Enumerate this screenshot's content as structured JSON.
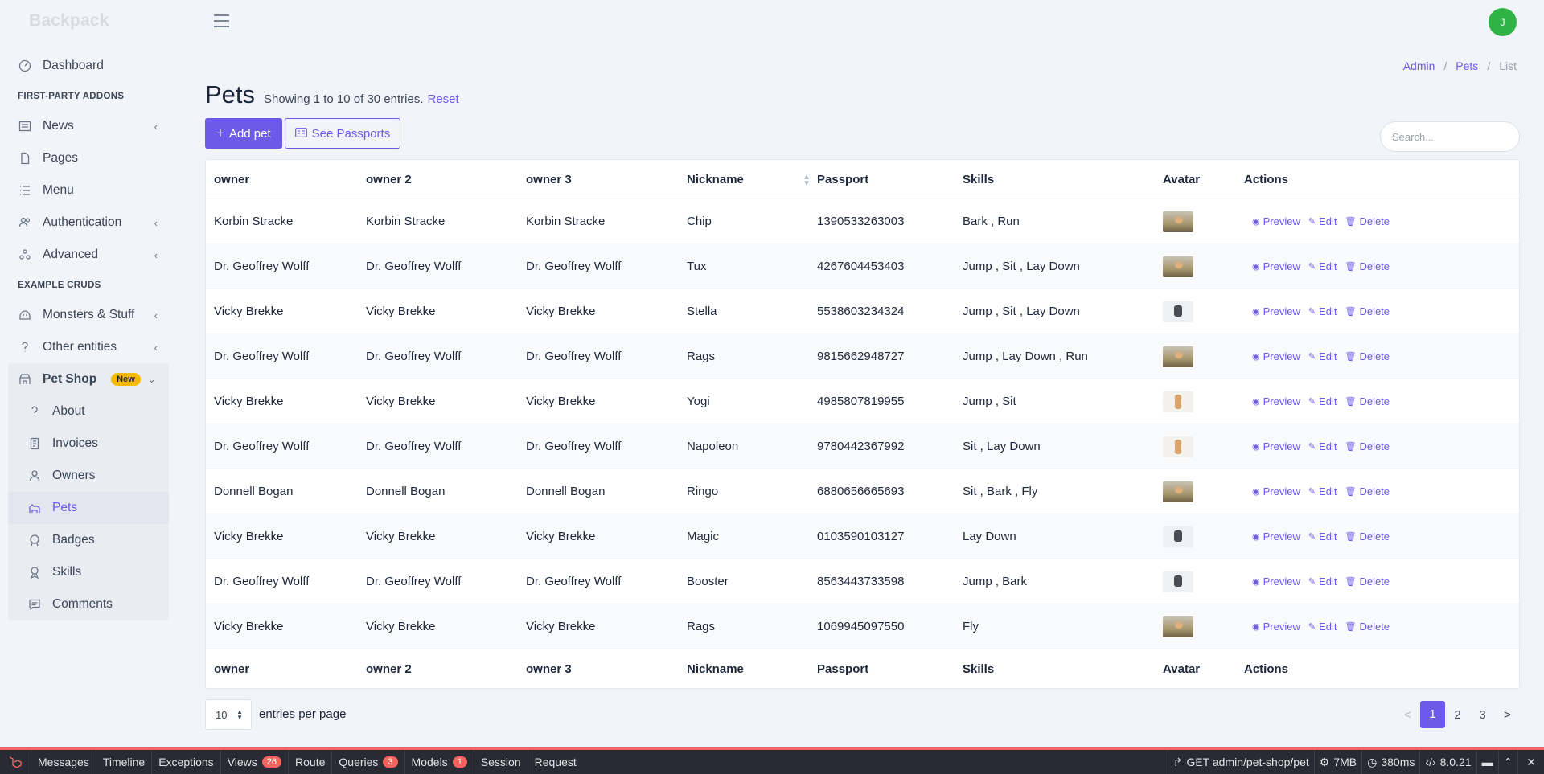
{
  "brand": "Backpack",
  "user": {
    "initial": "J"
  },
  "sidebar": {
    "dashboard": "Dashboard",
    "section1": "FIRST-PARTY ADDONS",
    "news": "News",
    "pages": "Pages",
    "menu": "Menu",
    "authentication": "Authentication",
    "advanced": "Advanced",
    "section2": "EXAMPLE CRUDS",
    "monsters": "Monsters & Stuff",
    "other": "Other entities",
    "petshop": "Pet Shop",
    "petshop_badge": "New",
    "sub": {
      "about": "About",
      "invoices": "Invoices",
      "owners": "Owners",
      "pets": "Pets",
      "badges": "Badges",
      "skills": "Skills",
      "comments": "Comments"
    }
  },
  "breadcrumb": {
    "admin": "Admin",
    "pets": "Pets",
    "list": "List",
    "sep": "/"
  },
  "page": {
    "title": "Pets",
    "info": "Showing 1 to 10 of 30 entries.",
    "reset": "Reset",
    "add_button": "Add pet",
    "passports_button": "See Passports",
    "search_placeholder": "Search..."
  },
  "table": {
    "columns": [
      "owner",
      "owner 2",
      "owner 3",
      "Nickname",
      "Passport",
      "Skills",
      "Avatar",
      "Actions"
    ],
    "actions": {
      "preview": "Preview",
      "edit": "Edit",
      "delete": "Delete"
    },
    "rows": [
      {
        "owner": "Korbin Stracke",
        "owner2": "Korbin Stracke",
        "owner3": "Korbin Stracke",
        "nickname": "Chip",
        "passport": "1390533263003",
        "skills": "Bark , Run",
        "avatar": "bird"
      },
      {
        "owner": "Dr. Geoffrey Wolff",
        "owner2": "Dr. Geoffrey Wolff",
        "owner3": "Dr. Geoffrey Wolff",
        "nickname": "Tux",
        "passport": "4267604453403",
        "skills": "Jump , Sit , Lay Down",
        "avatar": "bird"
      },
      {
        "owner": "Vicky Brekke",
        "owner2": "Vicky Brekke",
        "owner3": "Vicky Brekke",
        "nickname": "Stella",
        "passport": "5538603234324",
        "skills": "Jump , Sit , Lay Down",
        "avatar": "dog"
      },
      {
        "owner": "Dr. Geoffrey Wolff",
        "owner2": "Dr. Geoffrey Wolff",
        "owner3": "Dr. Geoffrey Wolff",
        "nickname": "Rags",
        "passport": "9815662948727",
        "skills": "Jump , Lay Down , Run",
        "avatar": "bird"
      },
      {
        "owner": "Vicky Brekke",
        "owner2": "Vicky Brekke",
        "owner3": "Vicky Brekke",
        "nickname": "Yogi",
        "passport": "4985807819955",
        "skills": "Jump , Sit",
        "avatar": "cat"
      },
      {
        "owner": "Dr. Geoffrey Wolff",
        "owner2": "Dr. Geoffrey Wolff",
        "owner3": "Dr. Geoffrey Wolff",
        "nickname": "Napoleon",
        "passport": "9780442367992",
        "skills": "Sit , Lay Down",
        "avatar": "cat"
      },
      {
        "owner": "Donnell Bogan",
        "owner2": "Donnell Bogan",
        "owner3": "Donnell Bogan",
        "nickname": "Ringo",
        "passport": "6880656665693",
        "skills": "Sit , Bark , Fly",
        "avatar": "bird"
      },
      {
        "owner": "Vicky Brekke",
        "owner2": "Vicky Brekke",
        "owner3": "Vicky Brekke",
        "nickname": "Magic",
        "passport": "0103590103127",
        "skills": "Lay Down",
        "avatar": "dog"
      },
      {
        "owner": "Dr. Geoffrey Wolff",
        "owner2": "Dr. Geoffrey Wolff",
        "owner3": "Dr. Geoffrey Wolff",
        "nickname": "Booster",
        "passport": "8563443733598",
        "skills": "Jump , Bark",
        "avatar": "dog"
      },
      {
        "owner": "Vicky Brekke",
        "owner2": "Vicky Brekke",
        "owner3": "Vicky Brekke",
        "nickname": "Rags",
        "passport": "1069945097550",
        "skills": "Fly",
        "avatar": "bird"
      }
    ]
  },
  "footer": {
    "per_page_value": "10",
    "per_page_label": "entries per page",
    "pages": [
      "1",
      "2",
      "3"
    ],
    "prev": "<",
    "next": ">",
    "current": "1"
  },
  "debugbar": {
    "messages": "Messages",
    "timeline": "Timeline",
    "exceptions": "Exceptions",
    "views": "Views",
    "views_count": "26",
    "route": "Route",
    "queries": "Queries",
    "queries_count": "3",
    "models": "Models",
    "models_count": "1",
    "session": "Session",
    "request": "Request",
    "route_info": "GET admin/pet-shop/pet",
    "memory": "7MB",
    "time": "380ms",
    "php": "8.0.21",
    "close": "✕"
  },
  "colors": {
    "accent": "#6c5be9",
    "avatar_bg": "#2fb344",
    "debug_bg": "#282b33",
    "debug_accent": "#f4645f"
  }
}
